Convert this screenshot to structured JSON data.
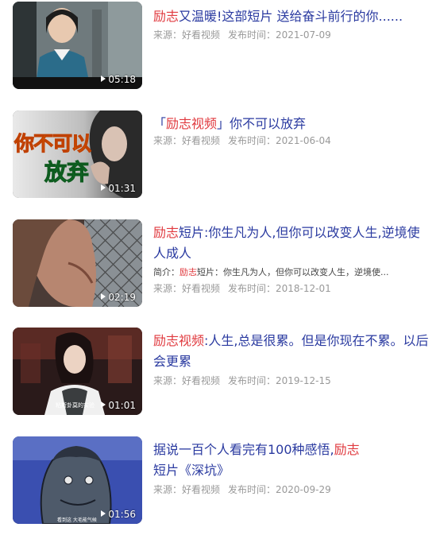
{
  "results": [
    {
      "title_parts": [
        {
          "text": "励志",
          "hl": true
        },
        {
          "text": "又温暖!这部短片 送给奋斗前行的你......",
          "hl": false
        }
      ],
      "duration": "05:18",
      "source_label": "来源：好看视频",
      "publish_label": "发布时间：2021-07-09"
    },
    {
      "title_parts": [
        {
          "text": "「",
          "hl": false
        },
        {
          "text": "励志视频",
          "hl": true
        },
        {
          "text": "」你不可以放弃",
          "hl": false
        }
      ],
      "duration": "01:31",
      "thumb_text_line1": "你不可以",
      "thumb_text_line2": "放弃",
      "source_label": "来源：好看视频",
      "publish_label": "发布时间：2021-06-04"
    },
    {
      "title_parts": [
        {
          "text": "励志",
          "hl": true
        },
        {
          "text": "短片:你生凡为人,但你可以改变人生,逆境使人成人",
          "hl": false
        }
      ],
      "summary_parts": [
        {
          "text": "简介：",
          "hl": false
        },
        {
          "text": "励志",
          "hl": true
        },
        {
          "text": "短片：你生凡为人，但你可以改变人生，逆境使...",
          "hl": false
        }
      ],
      "duration": "02:19",
      "source_label": "来源：好看视频",
      "publish_label": "发布时间：2018-12-01"
    },
    {
      "title_parts": [
        {
          "text": "励志视频",
          "hl": true
        },
        {
          "text": ":人生,总是很累。但是你现在不累。以后会更累",
          "hl": false
        }
      ],
      "duration": "01:01",
      "thumb_caption": "粘斯卦莫的实验",
      "source_label": "来源：好看视频",
      "publish_label": "发布时间：2019-12-15"
    },
    {
      "title_parts": [
        {
          "text": "据说一百个人看完有100种感悟,",
          "hl": false
        },
        {
          "text": "励志",
          "hl": true
        },
        {
          "text": "短片《深坑》",
          "hl": false
        }
      ],
      "duration": "01:56",
      "thumb_caption": "看到这  大毛能气候",
      "source_label": "来源：好看视频",
      "publish_label": "发布时间：2020-09-29"
    }
  ],
  "colors": {
    "title": "#2a3aa0",
    "highlight": "#e0393e",
    "meta": "#999999"
  },
  "icons": {
    "duration": "play-icon"
  }
}
